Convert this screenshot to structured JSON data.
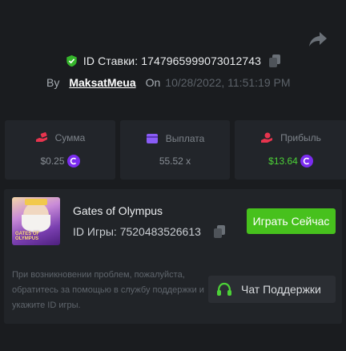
{
  "bet": {
    "id_label": "ID Ставки:",
    "id_value": "1747965999073012743",
    "by_label": "By",
    "username": "MaksatMeua",
    "on_label": "On",
    "datetime": "10/28/2022, 11:51:19 PM"
  },
  "stats": [
    {
      "label": "Сумма",
      "value": "$0.25",
      "icon": "money-hand-icon",
      "color": "#e8344e",
      "has_coin": true
    },
    {
      "label": "Выплата",
      "value": "55.52 x",
      "icon": "wallet-card-icon",
      "color": "#8a5cf6",
      "has_coin": false
    },
    {
      "label": "Прибыль",
      "value": "$13.64",
      "icon": "profit-hand-icon",
      "color": "#e8344e",
      "has_coin": true,
      "value_color": "#4cd137"
    }
  ],
  "game": {
    "title": "Gates of Olympus",
    "id_label": "ID Игры:",
    "id_value": "7520483526613",
    "thumb_text": "GATES OF OLYMPUS",
    "play_label": "Играть Сейчас"
  },
  "support": {
    "help_text": "При возникновении проблем, пожалуйста, обратитесь за помощью в службу поддержки и укажите ID игры.",
    "button_label": "Чат Поддержки",
    "icon": "headset-icon",
    "icon_color": "#4cd137"
  },
  "colors": {
    "accent_green": "#47c11d",
    "coin_purple": "#7b2cf0",
    "background": "#1a1c1f"
  }
}
